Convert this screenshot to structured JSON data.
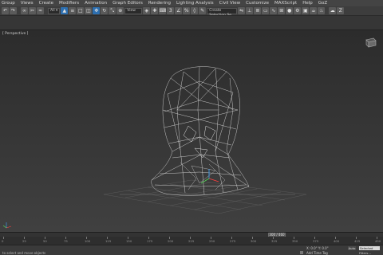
{
  "menu": [
    "Group",
    "Views",
    "Create",
    "Modifiers",
    "Animation",
    "Graph Editors",
    "Rendering",
    "Lighting Analysis",
    "Civil View",
    "Customize",
    "MAXScript",
    "Help",
    "GoZ"
  ],
  "toolbar": {
    "viewtype": "View",
    "selection_set": "Create Selection Se"
  },
  "viewport": {
    "label": "[ Perspective ]"
  },
  "timeline": {
    "slider": "300 / 460",
    "ticks": [
      "0",
      "25",
      "50",
      "75",
      "100",
      "125",
      "150",
      "175",
      "200",
      "225",
      "250",
      "275",
      "300",
      "325",
      "350",
      "375",
      "400",
      "425",
      "450"
    ]
  },
  "statusbar": {
    "text": "to select and move objects",
    "coords": "X: 0.0\"  Y: 0.0\"",
    "add_tag": "Add Time Tag",
    "auto": "Auto",
    "selected": "Selected",
    "filters": "Filters..."
  }
}
